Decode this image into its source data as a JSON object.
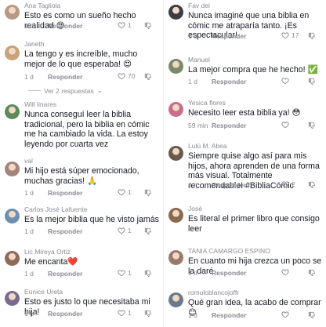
{
  "left_column": [
    {
      "user": "Ana Tagliola",
      "text": "Esto es como un sueño hecho realidad 😍",
      "time": "1 d",
      "reply": "Responder",
      "likes": "1",
      "avatar_color": "#b79a86"
    },
    {
      "user": "Janeth",
      "text": "La tengo y es increíble, mucho mejor de lo que esperaba! 😍",
      "time": "1 d",
      "reply": "Responder",
      "likes": "70",
      "avatar_color": "#c9a27a"
    },
    {
      "view_more": "Ver 2 respuestas"
    },
    {
      "user": "Will linares",
      "text": "Nunca conseguí leer la biblia tradicional, pero la biblia en cómic me ha cambiado la vida. La estoy leyendo por cuarta vez",
      "time": "",
      "reply": "",
      "likes": "",
      "avatar_color": "#5e8a5a"
    },
    {
      "user": "val",
      "text": "Mi hijo está súper emocionado, muchas gracias! 🙏",
      "time": "1 d",
      "reply": "Responder",
      "likes": "1",
      "avatar_color": "#a3857a"
    },
    {
      "user": "Carlos José Lafuente",
      "text": "Es la mejor biblia que he visto jamás",
      "time": "1 d",
      "reply": "Responder",
      "likes": "1",
      "avatar_color": "#6d8fb0"
    },
    {
      "user": "Lic Mireya Ortiz",
      "text": "Me encanta❤️",
      "time": "1 d",
      "reply": "Responder",
      "likes": "1",
      "avatar_color": "#8e6a5a"
    },
    {
      "user": "Eunice Ureta",
      "text": "Esto es justo lo que necesitaba mi hija!",
      "time": "1 h",
      "reply": "Responder",
      "likes": "1",
      "avatar_color": "#7a6a8e"
    }
  ],
  "right_column": [
    {
      "user": "Fav dei",
      "text": "Nunca imaginé que una biblia en cómic me atraparía tanto. ¡Es espectacular!",
      "time": "1 d",
      "reply": "Responder",
      "likes": "17",
      "avatar_color": "#3c3c48"
    },
    {
      "user": "Manuel",
      "text": "La mejor compra que he hecho! ✅",
      "time": "1 d",
      "reply": "Responder",
      "likes": "",
      "avatar_color": "#7a8a6a"
    },
    {
      "user": "Yesica flores",
      "text": "Necesito leer esta biblia ya! 😳",
      "time": "59 min",
      "reply": "Responder",
      "likes": "",
      "avatar_color": "#c96e8a"
    },
    {
      "user": "Lulú M. Abea",
      "text": "Siempre quise algo así para mis hijos, ahora aprenden de una forma más visual. Totalmente recomendable! #BibliaCómic",
      "time": "4 h",
      "reply": "Responder",
      "likes": "2",
      "avatar_color": "#6a5a4a"
    },
    {
      "user": "José",
      "text": "Es literal el primer libro que consigo leer",
      "time": "",
      "reply": "",
      "likes": "",
      "avatar_color": "#8a6a4e"
    },
    {
      "user": "TANIA CAMARGO ESPINO",
      "text": "En cuanto mi hija crezca un poco se la daré",
      "time": "1 d",
      "reply": "Responder",
      "likes": "",
      "avatar_color": "#9a7a6a"
    },
    {
      "user": "romuloblancojoffr",
      "text": "Qué gran idea, la acabo de comprar 😊",
      "time": "1 d",
      "reply": "Responder",
      "likes": "",
      "avatar_color": "#6a7a8a"
    }
  ],
  "colors": {
    "text": "#161823",
    "muted": "#8a8b91",
    "background": "#ffffff"
  },
  "icons": {
    "like": "heart-outline-icon",
    "dislike": "thumbs-down-icon",
    "view_more": "chevron-down-icon"
  }
}
